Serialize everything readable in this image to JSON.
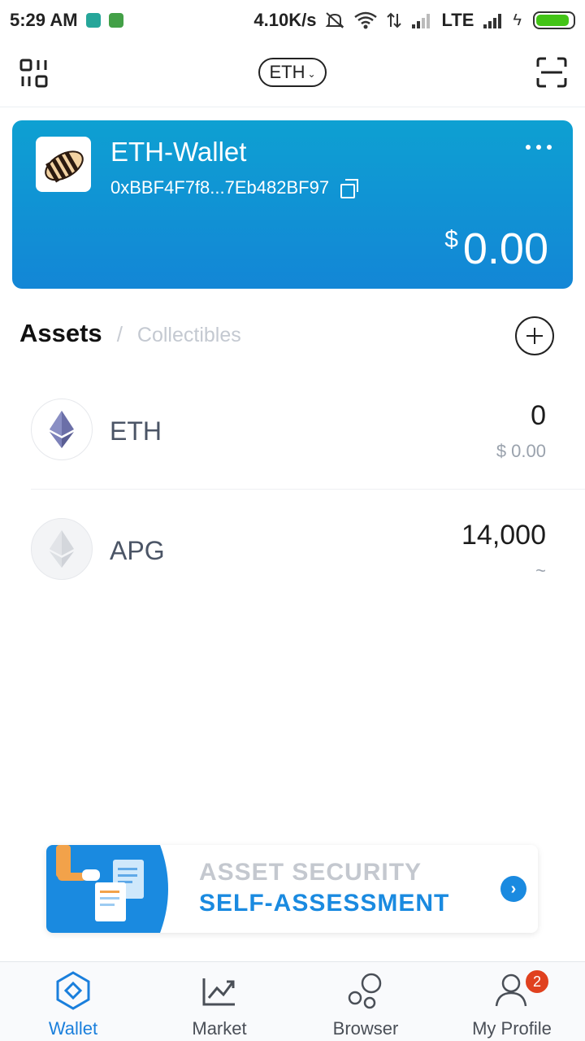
{
  "status_bar": {
    "time": "5:29 AM",
    "net_speed": "4.10K/s",
    "network_type": "LTE"
  },
  "header": {
    "network_selector": "ETH",
    "left_icon": "wallet-switch-icon",
    "right_icon": "scan-icon"
  },
  "wallet": {
    "name": "ETH-Wallet",
    "address": "0xBBF4F7f8...7Eb482BF97",
    "currency_symbol": "$",
    "balance": "0.00",
    "gradient_colors": [
      "#0ea0d2",
      "#1386d6"
    ]
  },
  "tabs": {
    "assets": "Assets",
    "separator": "/",
    "collectibles": "Collectibles"
  },
  "assets": [
    {
      "symbol": "ETH",
      "amount": "0",
      "fiat": "$ 0.00",
      "icon": "ethereum-icon"
    },
    {
      "symbol": "APG",
      "amount": "14,000",
      "fiat": "~",
      "icon": "ethereum-grey-icon"
    }
  ],
  "banner": {
    "line1": "ASSET SECURITY",
    "line2": "SELF-ASSESSMENT",
    "accent": "#1a8ae0"
  },
  "bottom_nav": {
    "items": [
      {
        "label": "Wallet",
        "icon": "wallet-hexagon-icon",
        "active": true
      },
      {
        "label": "Market",
        "icon": "chart-trend-icon",
        "active": false
      },
      {
        "label": "Browser",
        "icon": "browser-bubbles-icon",
        "active": false
      },
      {
        "label": "My Profile",
        "icon": "profile-icon",
        "active": false,
        "badge": "2"
      }
    ],
    "active_color": "#1a7fdc"
  }
}
